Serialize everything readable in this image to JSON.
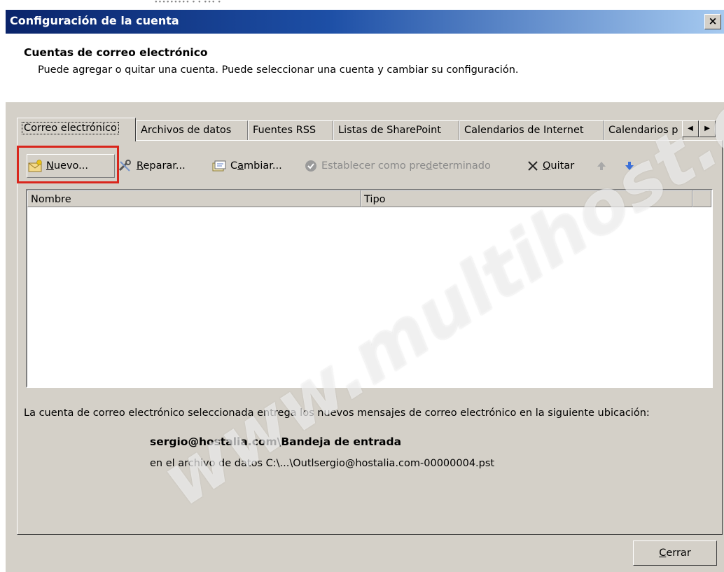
{
  "window": {
    "title": "Configuración de la cuenta",
    "close": "×"
  },
  "header": {
    "title": "Cuentas de correo electrónico",
    "description": "Puede agregar o quitar una cuenta. Puede seleccionar una cuenta y cambiar su configuración."
  },
  "tabs": [
    {
      "label": "Correo electrónico",
      "active": true
    },
    {
      "label": "Archivos de datos"
    },
    {
      "label": "Fuentes RSS"
    },
    {
      "label": "Listas de SharePoint"
    },
    {
      "label": "Calendarios de Internet"
    },
    {
      "label": "Calendarios p"
    }
  ],
  "tab_scroll": {
    "left": "◀",
    "right": "▶"
  },
  "toolbar": {
    "nuevo": {
      "pre": "",
      "key": "N",
      "post": "uevo..."
    },
    "reparar": {
      "pre": "",
      "key": "R",
      "post": "eparar..."
    },
    "cambiar": {
      "pre": "C",
      "key": "a",
      "post": "mbiar..."
    },
    "predeterminado": {
      "pre": "Establecer como pre",
      "key": "d",
      "post": "eterminado"
    },
    "quitar": {
      "pre": "",
      "key": "Q",
      "post": "uitar"
    }
  },
  "list": {
    "columns": [
      "Nombre",
      "Tipo"
    ],
    "rows": []
  },
  "info": {
    "text": "La cuenta de correo electrónico seleccionada entrega los nuevos mensajes de correo electrónico en la siguiente ubicación:",
    "account": "sergio@hostalia.com\\Bandeja de entrada",
    "file": "en el archivo de datos C:\\...\\Outlsergio@hostalia.com-00000004.pst"
  },
  "footer": {
    "close": {
      "pre": "",
      "key": "C",
      "post": "errar"
    }
  },
  "watermark": "www.multihost.cl",
  "colors": {
    "highlight": "#d9261c",
    "titlebar": "#0a246a",
    "dialog": "#d4d0c8"
  }
}
